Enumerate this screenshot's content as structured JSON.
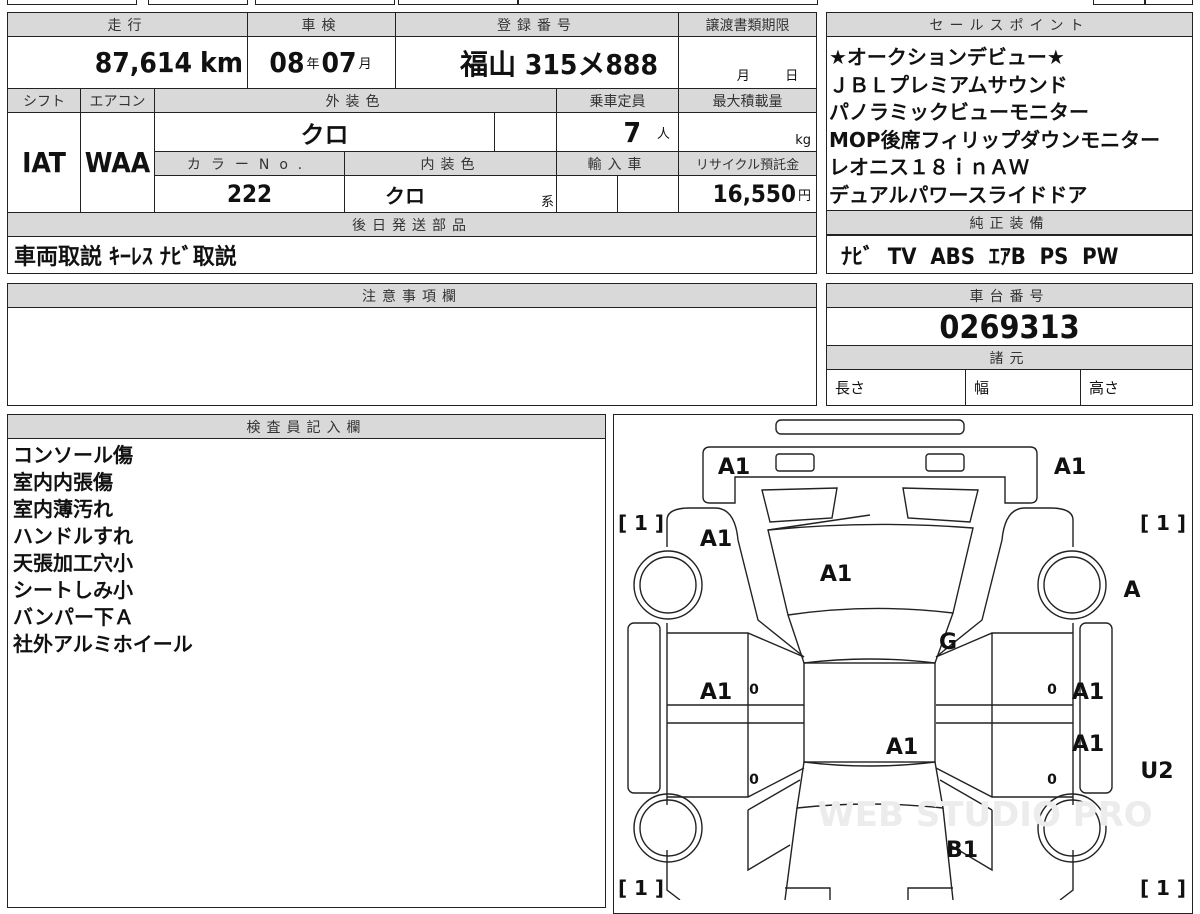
{
  "table": {
    "mileage_label": "走行",
    "mileage_value": "87,614",
    "mileage_unit": "km",
    "inspection_label": "車検",
    "inspection_year": "08",
    "year_unit": "年",
    "inspection_month": "07",
    "month_unit": "月",
    "registration_label": "登録番号",
    "registration_value": "福山 315メ888",
    "transfer_label": "譲渡書類期限",
    "transfer_month_unit": "月",
    "transfer_day_unit": "日",
    "shift_label": "シフト",
    "shift_value": "IAT",
    "ac_label": "エアコン",
    "ac_value": "WAA",
    "exterior_label": "外装色",
    "exterior_value": "クロ",
    "capacity_label": "乗車定員",
    "capacity_value": "7",
    "capacity_unit": "人",
    "load_label": "最大積載量",
    "load_unit": "kg",
    "color_no_label": "カラーNo.",
    "color_no_value": "222",
    "interior_label": "内装色",
    "interior_value": "クロ",
    "interior_unit": "系",
    "import_label": "輸入車",
    "recycle_label": "リサイクル預託金",
    "recycle_value": "16,550",
    "recycle_unit": "円",
    "later_parts_label": "後日発送部品",
    "later_parts_value": "車両取説 ｷｰﾚｽ ﾅﾋﾞ取説"
  },
  "sales_points": {
    "label": "セールスポイント",
    "items": [
      "★オークションデビュー★",
      "ＪＢＬプレミアムサウンド",
      "パノラミックビューモニター",
      "MOP後席フィリップダウンモニター",
      "レオニス１８ｉｎＡＷ",
      "デュアルパワースライドドア"
    ]
  },
  "equipment": {
    "label": "純正装備",
    "value": "ﾅﾋﾞ  TV  ABS  ｴｱB  PS  PW"
  },
  "notes": {
    "label": "注意事項欄",
    "value": ""
  },
  "chassis": {
    "label": "車台番号",
    "value": "0269313",
    "specs_label": "諸元",
    "length_label": "長さ",
    "width_label": "幅",
    "height_label": "高さ"
  },
  "inspector": {
    "label": "検査員記入欄",
    "items": [
      "コンソール傷",
      "室内内張傷",
      "室内薄汚れ",
      "ハンドルすれ",
      "天張加工穴小",
      "シートしみ小",
      "バンパー下Ａ",
      "社外アルミホイール"
    ]
  },
  "diagram": {
    "marks": {
      "front_left": "A1",
      "front_right": "A1",
      "fender_left": "A1",
      "hood": "A1",
      "wheel_right_front": "A",
      "windshield": "G",
      "door_left": "A1",
      "door_right_front": "A1",
      "door_right_rear": "A1",
      "roof": "A1",
      "sill_right": "U2",
      "trunk": "B1",
      "zero": "0"
    },
    "tire_bracket": "[ 1 ]",
    "watermark": "WEB STUDIO PRO"
  }
}
